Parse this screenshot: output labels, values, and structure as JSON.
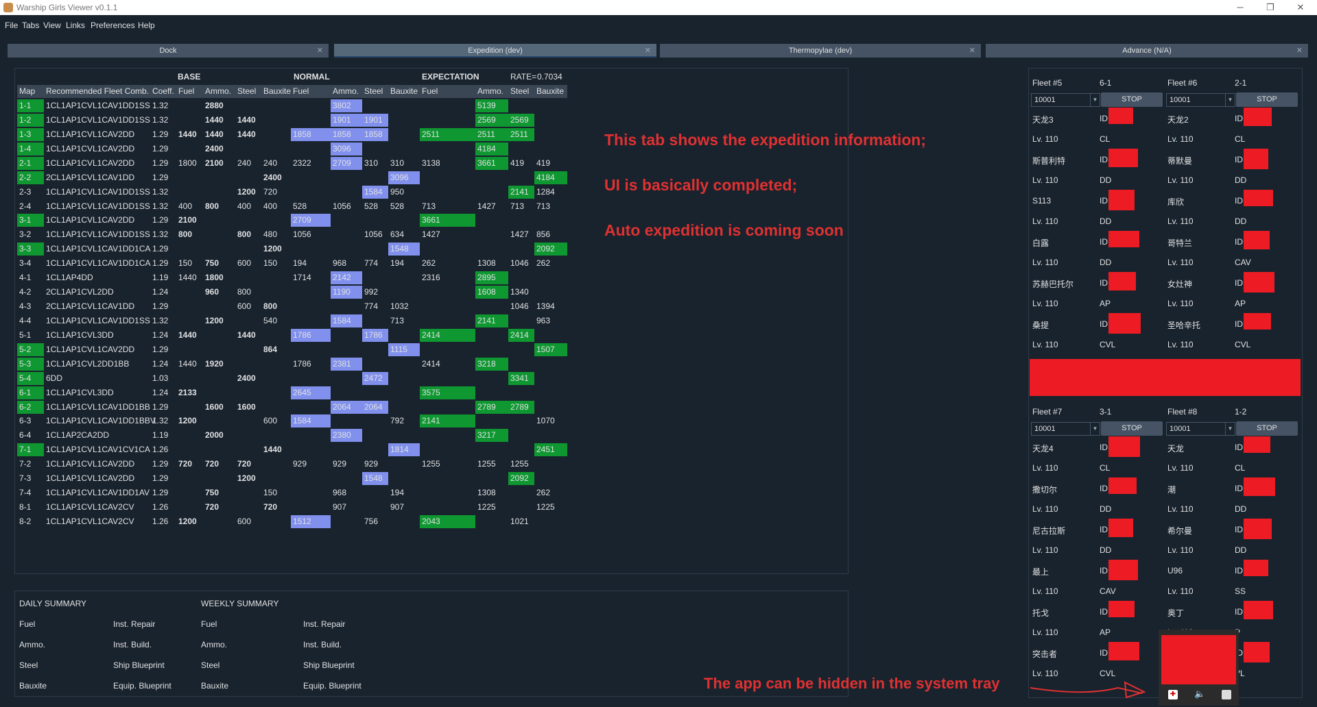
{
  "window": {
    "title": "Warship Girls Viewer v0.1.1",
    "min": "─",
    "restore": "❐",
    "close": "✕"
  },
  "menu": [
    "File",
    "Tabs",
    "View",
    "Links",
    "Preferences",
    "Help"
  ],
  "tabs": [
    {
      "label": "Dock"
    },
    {
      "label": "Expedition (dev)"
    },
    {
      "label": "Thermopylae (dev)"
    },
    {
      "label": "Advance (N/A)"
    }
  ],
  "table": {
    "groups": {
      "base": "BASE",
      "normal": "NORMAL",
      "expectation": "EXPECTATION",
      "rate_label": "RATE=",
      "rate": "0.7034"
    },
    "columns": [
      "Map",
      "Recommended Fleet Comb.",
      "Coeff.",
      "Fuel",
      "Ammo.",
      "Steel",
      "Bauxite",
      "Fuel",
      "Ammo.",
      "Steel",
      "Bauxite",
      "Fuel",
      "Ammo.",
      "Steel",
      "Bauxite"
    ],
    "rows": [
      [
        "1-1",
        "1CL1AP1CVL1CAV1DD1SS",
        "1.32",
        "",
        "2880",
        "",
        "",
        "",
        "3802",
        "",
        "",
        "",
        "5139",
        "",
        ""
      ],
      [
        "1-2",
        "1CL1AP1CVL1CAV1DD1SS",
        "1.32",
        "",
        "1440",
        "1440",
        "",
        "",
        "1901",
        "1901",
        "",
        "",
        "2569",
        "2569",
        ""
      ],
      [
        "1-3",
        "1CL1AP1CVL1CAV2DD",
        "1.29",
        "1440",
        "1440",
        "1440",
        "",
        "1858",
        "1858",
        "1858",
        "",
        "2511",
        "2511",
        "2511",
        ""
      ],
      [
        "1-4",
        "1CL1AP1CVL1CAV2DD",
        "1.29",
        "",
        "2400",
        "",
        "",
        "",
        "3096",
        "",
        "",
        "",
        "4184",
        "",
        ""
      ],
      [
        "2-1",
        "1CL1AP1CVL1CAV2DD",
        "1.29",
        "1800",
        "2100",
        "240",
        "240",
        "2322",
        "2709",
        "310",
        "310",
        "3138",
        "3661",
        "419",
        "419"
      ],
      [
        "2-2",
        "2CL1AP1CVL1CAV1DD",
        "1.29",
        "",
        "",
        "",
        "2400",
        "",
        "",
        "",
        "3096",
        "",
        "",
        "",
        "4184"
      ],
      [
        "2-3",
        "1CL1AP1CVL1CAV1DD1SS",
        "1.32",
        "",
        "",
        "1200",
        "720",
        "",
        "",
        "1584",
        "950",
        "",
        "",
        "2141",
        "1284"
      ],
      [
        "2-4",
        "1CL1AP1CVL1CAV1DD1SS",
        "1.32",
        "400",
        "800",
        "400",
        "400",
        "528",
        "1056",
        "528",
        "528",
        "713",
        "1427",
        "713",
        "713"
      ],
      [
        "3-1",
        "1CL1AP1CVL1CAV2DD",
        "1.29",
        "2100",
        "",
        "",
        "",
        "2709",
        "",
        "",
        "",
        "3661",
        "",
        "",
        ""
      ],
      [
        "3-2",
        "1CL1AP1CVL1CAV1DD1SS",
        "1.32",
        "800",
        "",
        "800",
        "480",
        "1056",
        "",
        "1056",
        "634",
        "1427",
        "",
        "1427",
        "856"
      ],
      [
        "3-3",
        "1CL1AP1CVL1CAV1DD1CA",
        "1.29",
        "",
        "",
        "",
        "1200",
        "",
        "",
        "",
        "1548",
        "",
        "",
        "",
        "2092"
      ],
      [
        "3-4",
        "1CL1AP1CVL1CAV1DD1CA",
        "1.29",
        "150",
        "750",
        "600",
        "150",
        "194",
        "968",
        "774",
        "194",
        "262",
        "1308",
        "1046",
        "262"
      ],
      [
        "4-1",
        "1CL1AP4DD",
        "1.19",
        "1440",
        "1800",
        "",
        "",
        "1714",
        "2142",
        "",
        "",
        "2316",
        "2895",
        "",
        ""
      ],
      [
        "4-2",
        "2CL1AP1CVL2DD",
        "1.24",
        "",
        "960",
        "800",
        "",
        "",
        "1190",
        "992",
        "",
        "",
        "1608",
        "1340",
        ""
      ],
      [
        "4-3",
        "2CL1AP1CVL1CAV1DD",
        "1.29",
        "",
        "",
        "600",
        "800",
        "",
        "",
        "774",
        "1032",
        "",
        "",
        "1046",
        "1394"
      ],
      [
        "4-4",
        "1CL1AP1CVL1CAV1DD1SS",
        "1.32",
        "",
        "1200",
        "",
        "540",
        "",
        "1584",
        "",
        "713",
        "",
        "2141",
        "",
        "963"
      ],
      [
        "5-1",
        "1CL1AP1CVL3DD",
        "1.24",
        "1440",
        "",
        "1440",
        "",
        "1786",
        "",
        "1786",
        "",
        "2414",
        "",
        "2414",
        ""
      ],
      [
        "5-2",
        "1CL1AP1CVL1CAV2DD",
        "1.29",
        "",
        "",
        "",
        "864",
        "",
        "",
        "",
        "1115",
        "",
        "",
        "",
        "1507"
      ],
      [
        "5-3",
        "1CL1AP1CVL2DD1BB",
        "1.24",
        "1440",
        "1920",
        "",
        "",
        "1786",
        "2381",
        "",
        "",
        "2414",
        "3218",
        "",
        ""
      ],
      [
        "5-4",
        "6DD",
        "1.03",
        "",
        "",
        "2400",
        "",
        "",
        "",
        "2472",
        "",
        "",
        "",
        "3341",
        ""
      ],
      [
        "6-1",
        "1CL1AP1CVL3DD",
        "1.24",
        "2133",
        "",
        "",
        "",
        "2645",
        "",
        "",
        "",
        "3575",
        "",
        "",
        ""
      ],
      [
        "6-2",
        "1CL1AP1CVL1CAV1DD1BB",
        "1.29",
        "",
        "1600",
        "1600",
        "",
        "",
        "2064",
        "2064",
        "",
        "",
        "2789",
        "2789",
        ""
      ],
      [
        "6-3",
        "1CL1AP1CVL1CAV1DD1BBV",
        "1.32",
        "1200",
        "",
        "",
        "600",
        "1584",
        "",
        "",
        "792",
        "2141",
        "",
        "",
        "1070"
      ],
      [
        "6-4",
        "1CL1AP2CA2DD",
        "1.19",
        "",
        "2000",
        "",
        "",
        "",
        "2380",
        "",
        "",
        "",
        "3217",
        "",
        ""
      ],
      [
        "7-1",
        "1CL1AP1CVL1CAV1CV1CA",
        "1.26",
        "",
        "",
        "",
        "1440",
        "",
        "",
        "",
        "1814",
        "",
        "",
        "",
        "2451"
      ],
      [
        "7-2",
        "1CL1AP1CVL1CAV2DD",
        "1.29",
        "720",
        "720",
        "720",
        "",
        "929",
        "929",
        "929",
        "",
        "1255",
        "1255",
        "1255",
        ""
      ],
      [
        "7-3",
        "1CL1AP1CVL1CAV2DD",
        "1.29",
        "",
        "",
        "1200",
        "",
        "",
        "",
        "1548",
        "",
        "",
        "",
        "2092",
        ""
      ],
      [
        "7-4",
        "1CL1AP1CVL1CAV1DD1AV",
        "1.29",
        "",
        "750",
        "",
        "150",
        "",
        "968",
        "",
        "194",
        "",
        "1308",
        "",
        "262"
      ],
      [
        "8-1",
        "1CL1AP1CVL1CAV2CV",
        "1.26",
        "",
        "720",
        "",
        "720",
        "",
        "907",
        "",
        "907",
        "",
        "1225",
        "",
        "1225"
      ],
      [
        "8-2",
        "1CL1AP1CVL1CAV2CV",
        "1.26",
        "1200",
        "",
        "600",
        "",
        "1512",
        "",
        "756",
        "",
        "2043",
        "",
        "1021",
        ""
      ]
    ],
    "green_map_rows": [
      "1-1",
      "1-2",
      "1-3",
      "1-4",
      "2-1",
      "2-2",
      "3-1",
      "3-3",
      "5-2",
      "5-3",
      "5-4",
      "6-1",
      "6-2",
      "7-1"
    ],
    "colors": {
      "green": "#0f9731",
      "purple": "#8090ec"
    }
  },
  "annotations": {
    "line1": "This tab shows the expedition information;",
    "line2": "UI is basically completed;",
    "line3": "Auto expedition is coming soon",
    "tray_note": "The app can be hidden in the system tray",
    "color": "#e03131"
  },
  "summary": {
    "daily_title": "DAILY SUMMARY",
    "weekly_title": "WEEKLY SUMMARY",
    "resources": [
      "Fuel",
      "Ammo.",
      "Steel",
      "Bauxite"
    ],
    "items": [
      "Inst. Repair",
      "Inst. Build.",
      "Ship Blueprint",
      "Equip. Blueprint"
    ]
  },
  "fleets": [
    {
      "name": "Fleet #5",
      "map": "6-1",
      "combo": "10001",
      "button": "STOP",
      "ships": [
        {
          "name": "天龙3",
          "level": "Lv. 110",
          "type": "CL"
        },
        {
          "name": "斯普利特",
          "level": "Lv. 110",
          "type": "DD"
        },
        {
          "name": "S113",
          "level": "Lv. 110",
          "type": "DD"
        },
        {
          "name": "白露",
          "level": "Lv. 110",
          "type": "DD"
        },
        {
          "name": "苏赫巴托尔",
          "level": "Lv. 110",
          "type": "AP"
        },
        {
          "name": "桑提",
          "level": "Lv. 110",
          "type": "CVL"
        }
      ]
    },
    {
      "name": "Fleet #6",
      "map": "2-1",
      "combo": "10001",
      "button": "STOP",
      "ships": [
        {
          "name": "天龙2",
          "level": "Lv. 110",
          "type": "CL"
        },
        {
          "name": "蒂默曼",
          "level": "Lv. 110",
          "type": "DD"
        },
        {
          "name": "库欣",
          "level": "Lv. 110",
          "type": "DD"
        },
        {
          "name": "哥特兰",
          "level": "Lv. 110",
          "type": "CAV"
        },
        {
          "name": "女灶神",
          "level": "Lv. 110",
          "type": "AP"
        },
        {
          "name": "圣哈辛托",
          "level": "Lv. 110",
          "type": "CVL"
        }
      ]
    },
    {
      "name": "Fleet #7",
      "map": "3-1",
      "combo": "10001",
      "button": "STOP",
      "ships": [
        {
          "name": "天龙4",
          "level": "Lv. 110",
          "type": "CL"
        },
        {
          "name": "撒切尔",
          "level": "Lv. 110",
          "type": "DD"
        },
        {
          "name": "尼古拉斯",
          "level": "Lv. 110",
          "type": "DD"
        },
        {
          "name": "最上",
          "level": "Lv. 110",
          "type": "CAV"
        },
        {
          "name": "托戈",
          "level": "Lv. 110",
          "type": "AP"
        },
        {
          "name": "突击者",
          "level": "Lv. 110",
          "type": "CVL"
        }
      ]
    },
    {
      "name": "Fleet #8",
      "map": "1-2",
      "combo": "10001",
      "button": "STOP",
      "ships": [
        {
          "name": "天龙",
          "level": "Lv. 110",
          "type": "CL"
        },
        {
          "name": "潮",
          "level": "Lv. 110",
          "type": "DD"
        },
        {
          "name": "希尔曼",
          "level": "Lv. 110",
          "type": "DD"
        },
        {
          "name": "U96",
          "level": "Lv. 110",
          "type": "SS"
        },
        {
          "name": "奥丁",
          "level": "Lv. 110",
          "type": "P"
        },
        {
          "name": "",
          "level": "",
          "type": "VL"
        }
      ]
    }
  ],
  "id_label": "ID"
}
